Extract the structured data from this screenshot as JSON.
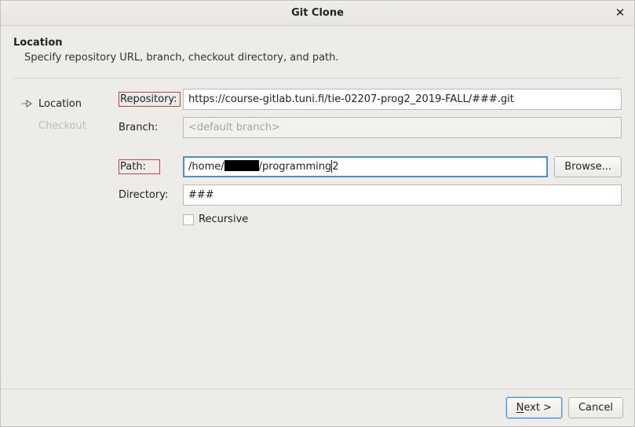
{
  "window": {
    "title": "Git Clone"
  },
  "header": {
    "heading": "Location",
    "subheading": "Specify repository URL, branch, checkout directory, and path."
  },
  "steps": {
    "location": "Location",
    "checkout": "Checkout"
  },
  "form": {
    "repository_label": "Repository:",
    "repository_value": "https://course-gitlab.tuni.fi/tie-02207-prog2_2019-FALL/###.git",
    "branch_label": "Branch:",
    "branch_placeholder": "<default branch>",
    "path_label": "Path:",
    "path_prefix": "/home/",
    "path_suffix": "/programming",
    "path_tail": "2",
    "browse_label": "Browse...",
    "directory_label": "Directory:",
    "directory_value": "###",
    "recursive_label": "Recursive"
  },
  "footer": {
    "next_prefix": "N",
    "next_rest": "ext >",
    "cancel": "Cancel"
  },
  "icons": {
    "step_arrow": "step-arrow-icon",
    "close": "close-icon"
  }
}
